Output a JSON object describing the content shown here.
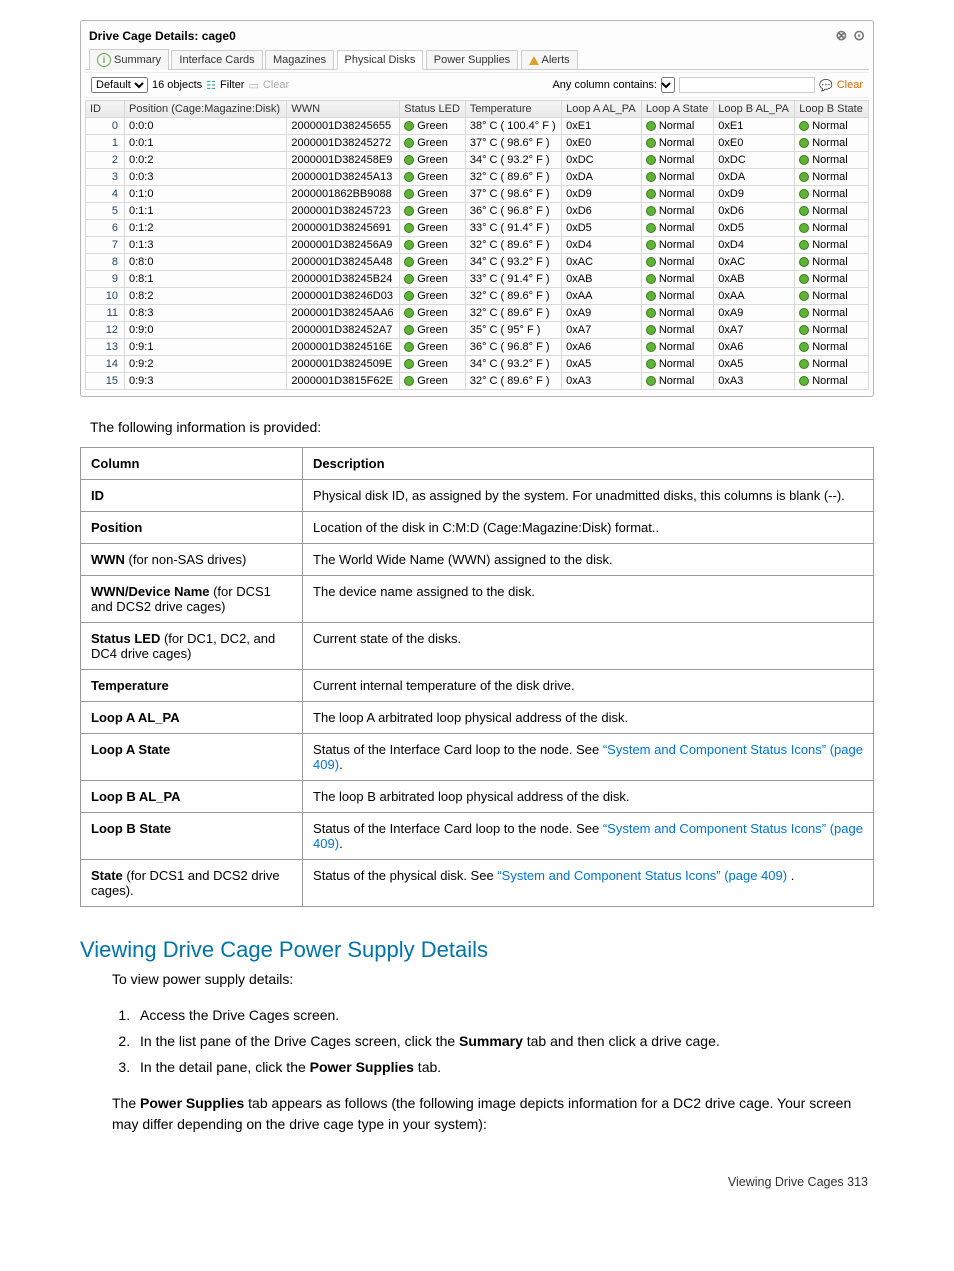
{
  "panel": {
    "title": "Drive Cage Details: cage0",
    "tabs": [
      "Summary",
      "Interface Cards",
      "Magazines",
      "Physical Disks",
      "Power Supplies",
      "Alerts"
    ],
    "active_tab": 3,
    "filter_default": "Default",
    "object_count": "16 objects",
    "filter_label": "Filter",
    "clear_left": "Clear",
    "any_col": "Any column contains:",
    "clear_right": "Clear"
  },
  "grid": {
    "headers": [
      "ID",
      "Position (Cage:Magazine:Disk)",
      "WWN",
      "Status LED",
      "Temperature",
      "Loop A AL_PA",
      "Loop A State",
      "Loop B AL_PA",
      "Loop B State"
    ],
    "rows": [
      {
        "id": "0",
        "pos": "0:0:0",
        "wwn": "2000001D38245655",
        "led": "Green",
        "temp": "38° C ( 100.4° F )",
        "la": "0xE1",
        "las": "Normal",
        "lb": "0xE1",
        "lbs": "Normal"
      },
      {
        "id": "1",
        "pos": "0:0:1",
        "wwn": "2000001D38245272",
        "led": "Green",
        "temp": "37° C ( 98.6° F )",
        "la": "0xE0",
        "las": "Normal",
        "lb": "0xE0",
        "lbs": "Normal"
      },
      {
        "id": "2",
        "pos": "0:0:2",
        "wwn": "2000001D382458E9",
        "led": "Green",
        "temp": "34° C ( 93.2° F )",
        "la": "0xDC",
        "las": "Normal",
        "lb": "0xDC",
        "lbs": "Normal"
      },
      {
        "id": "3",
        "pos": "0:0:3",
        "wwn": "2000001D38245A13",
        "led": "Green",
        "temp": "32° C ( 89.6° F )",
        "la": "0xDA",
        "las": "Normal",
        "lb": "0xDA",
        "lbs": "Normal"
      },
      {
        "id": "4",
        "pos": "0:1:0",
        "wwn": "2000001862BB9088",
        "led": "Green",
        "temp": "37° C ( 98.6° F )",
        "la": "0xD9",
        "las": "Normal",
        "lb": "0xD9",
        "lbs": "Normal"
      },
      {
        "id": "5",
        "pos": "0:1:1",
        "wwn": "2000001D38245723",
        "led": "Green",
        "temp": "36° C ( 96.8° F )",
        "la": "0xD6",
        "las": "Normal",
        "lb": "0xD6",
        "lbs": "Normal"
      },
      {
        "id": "6",
        "pos": "0:1:2",
        "wwn": "2000001D38245691",
        "led": "Green",
        "temp": "33° C ( 91.4° F )",
        "la": "0xD5",
        "las": "Normal",
        "lb": "0xD5",
        "lbs": "Normal"
      },
      {
        "id": "7",
        "pos": "0:1:3",
        "wwn": "2000001D382456A9",
        "led": "Green",
        "temp": "32° C ( 89.6° F )",
        "la": "0xD4",
        "las": "Normal",
        "lb": "0xD4",
        "lbs": "Normal"
      },
      {
        "id": "8",
        "pos": "0:8:0",
        "wwn": "2000001D38245A48",
        "led": "Green",
        "temp": "34° C ( 93.2° F )",
        "la": "0xAC",
        "las": "Normal",
        "lb": "0xAC",
        "lbs": "Normal"
      },
      {
        "id": "9",
        "pos": "0:8:1",
        "wwn": "2000001D38245B24",
        "led": "Green",
        "temp": "33° C ( 91.4° F )",
        "la": "0xAB",
        "las": "Normal",
        "lb": "0xAB",
        "lbs": "Normal"
      },
      {
        "id": "10",
        "pos": "0:8:2",
        "wwn": "2000001D38246D03",
        "led": "Green",
        "temp": "32° C ( 89.6° F )",
        "la": "0xAA",
        "las": "Normal",
        "lb": "0xAA",
        "lbs": "Normal"
      },
      {
        "id": "11",
        "pos": "0:8:3",
        "wwn": "2000001D38245AA6",
        "led": "Green",
        "temp": "32° C ( 89.6° F )",
        "la": "0xA9",
        "las": "Normal",
        "lb": "0xA9",
        "lbs": "Normal"
      },
      {
        "id": "12",
        "pos": "0:9:0",
        "wwn": "2000001D382452A7",
        "led": "Green",
        "temp": "35° C ( 95° F )",
        "la": "0xA7",
        "las": "Normal",
        "lb": "0xA7",
        "lbs": "Normal"
      },
      {
        "id": "13",
        "pos": "0:9:1",
        "wwn": "2000001D3824516E",
        "led": "Green",
        "temp": "36° C ( 96.8° F )",
        "la": "0xA6",
        "las": "Normal",
        "lb": "0xA6",
        "lbs": "Normal"
      },
      {
        "id": "14",
        "pos": "0:9:2",
        "wwn": "2000001D3824509E",
        "led": "Green",
        "temp": "34° C ( 93.2° F )",
        "la": "0xA5",
        "las": "Normal",
        "lb": "0xA5",
        "lbs": "Normal"
      },
      {
        "id": "15",
        "pos": "0:9:3",
        "wwn": "2000001D3815F62E",
        "led": "Green",
        "temp": "32° C ( 89.6° F )",
        "la": "0xA3",
        "las": "Normal",
        "lb": "0xA3",
        "lbs": "Normal"
      }
    ]
  },
  "caption": "The following information is provided:",
  "desc_header": {
    "col": "Column",
    "desc": "Description"
  },
  "desc_rows": [
    {
      "col": "<b>ID</b>",
      "desc": "Physical disk ID, as assigned by the system. For unadmitted disks, this columns is blank (--)."
    },
    {
      "col": "<b>Position</b>",
      "desc": "Location of the disk in C:M:D (Cage:Magazine:Disk) format.."
    },
    {
      "col": "<b>WWN</b> (for non-SAS drives)",
      "desc": "The World Wide Name (WWN) assigned to the disk."
    },
    {
      "col": "<b>WWN/Device Name</b> (for DCS1 and DCS2 drive cages)",
      "desc": "The device name assigned to the disk."
    },
    {
      "col": "<b>Status LED</b> (for DC1, DC2, and DC4 drive cages)",
      "desc": "Current state of the disks."
    },
    {
      "col": "<b>Temperature</b>",
      "desc": "Current internal temperature of the disk drive."
    },
    {
      "col": "<b>Loop A AL_PA</b>",
      "desc": "The loop A arbitrated loop physical address of the disk."
    },
    {
      "col": "<b>Loop A State</b>",
      "desc": "Status of the Interface Card loop to the node. See <a class='doclink' href='#'>“System and Component Status Icons” (page 409)</a>."
    },
    {
      "col": "<b>Loop B AL_PA</b>",
      "desc": "The loop B arbitrated loop physical address of the disk."
    },
    {
      "col": "<b>Loop B State</b>",
      "desc": "Status of the Interface Card loop to the node. See <a class='doclink' href='#'>“System and Component Status Icons” (page 409)</a>."
    },
    {
      "col": "<b>State</b> (for DCS1 and DCS2 drive cages).",
      "desc": "Status of the physical disk. See <a class='doclink' href='#'>“System and Component Status Icons” (page 409)</a> ."
    }
  ],
  "section_title": "Viewing Drive Cage Power Supply Details",
  "section_intro": "To view power supply details:",
  "steps": [
    "Access the Drive Cages screen.",
    "In the list pane of the Drive Cages screen, click the <b>Summary</b> tab and then click a drive cage.",
    "In the detail pane, click the <b>Power Supplies</b> tab."
  ],
  "section_after": "The <b>Power Supplies</b> tab appears as follows (the following image depicts information for a DC2 drive cage. Your screen may differ depending on the drive cage type in your system):",
  "footer": "Viewing Drive Cages   313"
}
